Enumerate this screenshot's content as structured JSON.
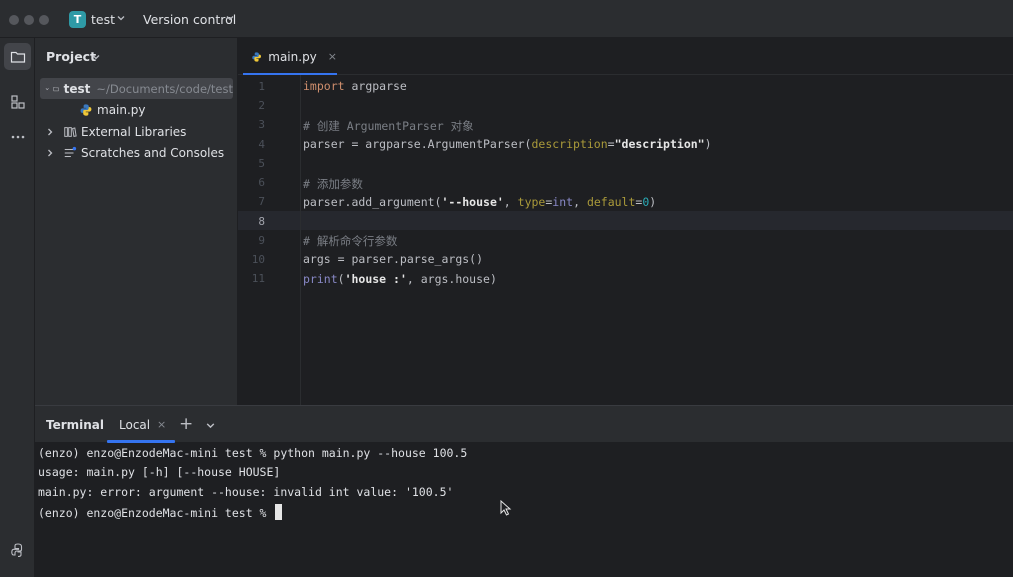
{
  "titlebar": {
    "project_badge": "T",
    "project_name": "test",
    "version_control": "Version control"
  },
  "project_panel": {
    "title": "Project",
    "root": {
      "name": "test",
      "path": "~/Documents/code/test"
    },
    "items": [
      {
        "name": "main.py"
      },
      {
        "name": "External Libraries"
      },
      {
        "name": "Scratches and Consoles"
      }
    ]
  },
  "editor": {
    "tab": {
      "label": "main.py",
      "close": "×"
    },
    "current_line": 8,
    "line_numbers": [
      "1",
      "2",
      "3",
      "4",
      "5",
      "6",
      "7",
      "8",
      "9",
      "10",
      "11"
    ],
    "code": {
      "l1_kw": "import",
      "l1_rest": " argparse",
      "l3": "# 创建 ArgumentParser 对象",
      "l4_a": "parser = argparse.ArgumentParser(",
      "l4_param": "description",
      "l4_eq": "=",
      "l4_str": "\"description\"",
      "l4_end": ")",
      "l6": "# 添加参数",
      "l7_a": "parser.add_argument(",
      "l7_str": "'--house'",
      "l7_sep1": ", ",
      "l7_param1": "type",
      "l7_eq1": "=",
      "l7_type": "int",
      "l7_sep2": ", ",
      "l7_param2": "default",
      "l7_eq2": "=",
      "l7_num": "0",
      "l7_end": ")",
      "l9": "# 解析命令行参数",
      "l10": "args = parser.parse_args()",
      "l11_fn": "print",
      "l11_open": "(",
      "l11_str": "'house :'",
      "l11_rest": ", args.house)"
    }
  },
  "terminal": {
    "title": "Terminal",
    "tab_label": "Local",
    "tab_close": "×",
    "add": "+",
    "lines": [
      "(enzo) enzo@EnzodeMac-mini test % python main.py --house 100.5",
      "usage: main.py [-h] [--house HOUSE]",
      "main.py: error: argument --house: invalid int value: '100.5'",
      "(enzo) enzo@EnzodeMac-mini test % "
    ]
  }
}
